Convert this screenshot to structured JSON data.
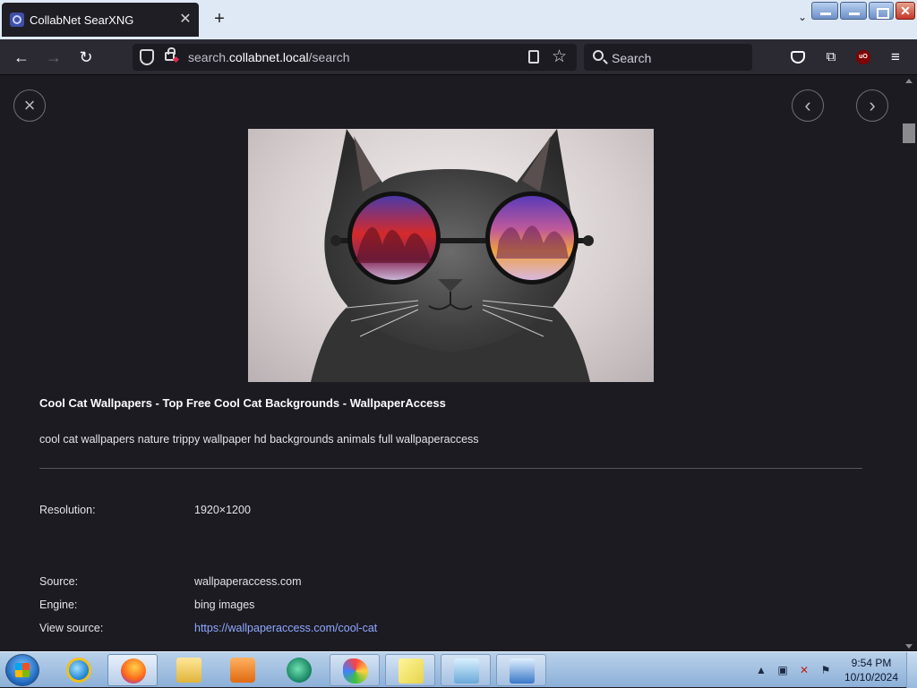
{
  "browser": {
    "tab_title": "CollabNet SearXNG",
    "url_prefix": "search.",
    "url_host": "collabnet.local",
    "url_path": "/search",
    "search_placeholder": "Search",
    "ubo_label": "uO"
  },
  "viewer": {
    "title": "Cool Cat Wallpapers - Top Free Cool Cat Backgrounds - WallpaperAccess",
    "description": "cool cat wallpapers nature trippy wallpaper hd backgrounds animals full wallpaperaccess",
    "resolution_label": "Resolution:",
    "resolution_value": "1920×1200",
    "source_label": "Source:",
    "source_value": "wallpaperaccess.com",
    "engine_label": "Engine:",
    "engine_value": "bing images",
    "view_source_label": "View source:",
    "view_source_value": "https://wallpaperaccess.com/cool-cat"
  },
  "taskbar": {
    "time": "9:54 PM",
    "date": "10/10/2024"
  },
  "colors": {
    "page_bg": "#1c1b22",
    "link": "#8fa8ff"
  }
}
